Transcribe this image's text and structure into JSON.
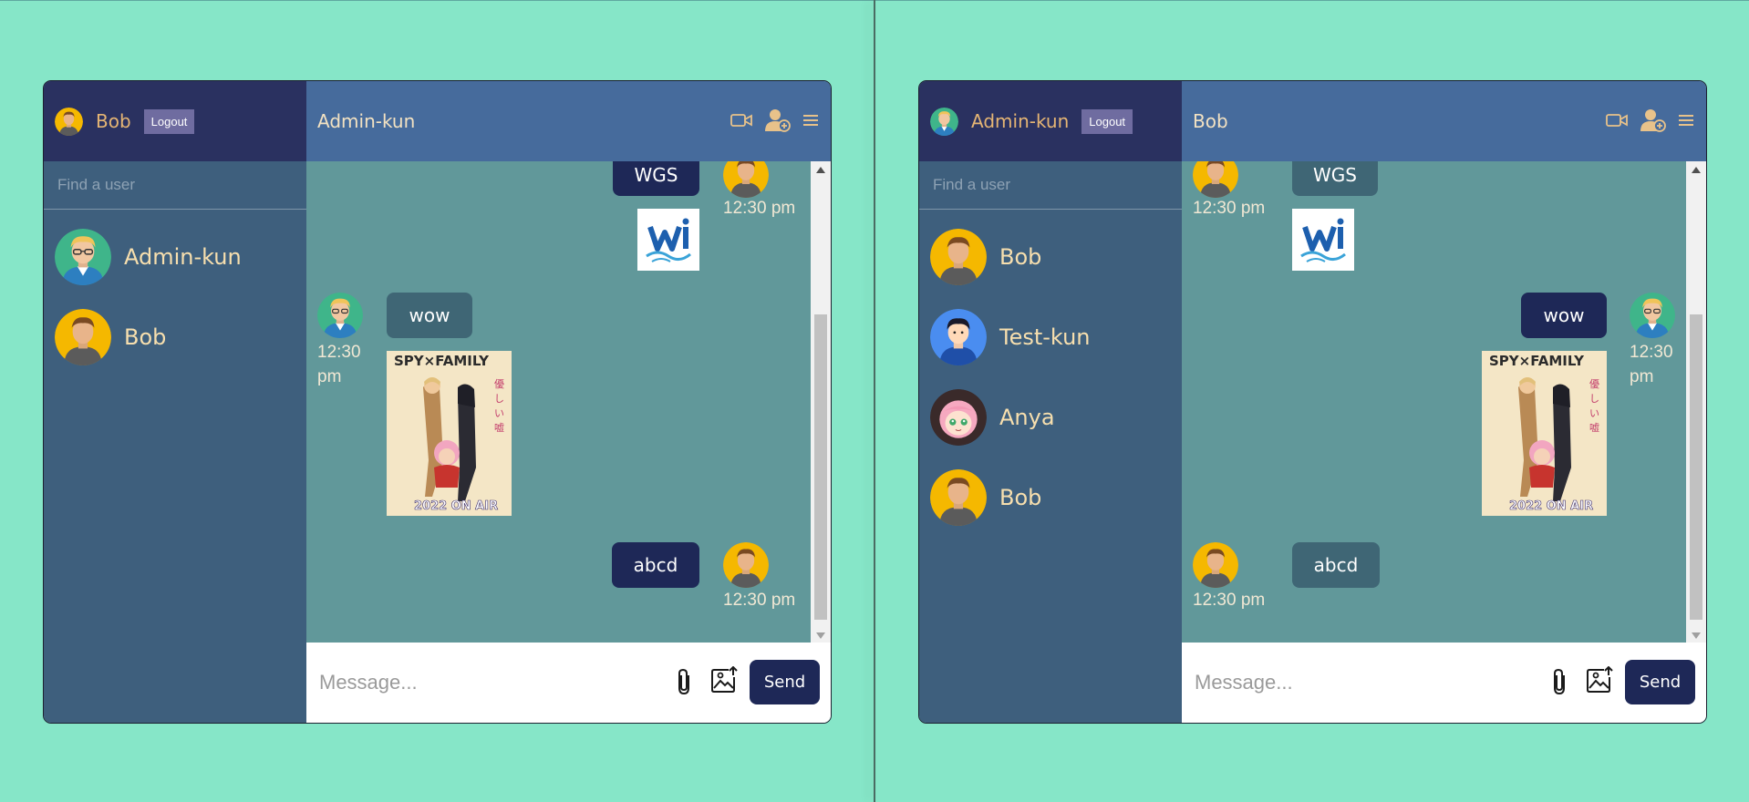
{
  "left": {
    "me": {
      "name": "Bob",
      "avatar": "bob-avatar"
    },
    "logout_label": "Logout",
    "search_placeholder": "Find a user",
    "users": [
      {
        "name": "Admin-kun",
        "avatar": "admin-avatar"
      },
      {
        "name": "Bob",
        "avatar": "bob-avatar"
      }
    ],
    "chat_title": "Admin-kun",
    "messages": [
      {
        "text": "WGS",
        "time": "12:30 pm",
        "image": "wgs-logo",
        "side": "right"
      },
      {
        "text": "wow",
        "time": "12:30 pm",
        "image": "spy-family-poster",
        "side": "left"
      },
      {
        "text": "abcd",
        "time": "12:30 pm",
        "side": "right"
      }
    ],
    "composer_placeholder": "Message...",
    "send_label": "Send"
  },
  "right": {
    "me": {
      "name": "Admin-kun",
      "avatar": "admin-avatar"
    },
    "logout_label": "Logout",
    "search_placeholder": "Find a user",
    "users": [
      {
        "name": "Bob",
        "avatar": "bob-avatar"
      },
      {
        "name": "Test-kun",
        "avatar": "test-avatar"
      },
      {
        "name": "Anya",
        "avatar": "anya-avatar"
      },
      {
        "name": "Bob",
        "avatar": "bob-avatar"
      }
    ],
    "chat_title": "Bob",
    "messages": [
      {
        "text": "WGS",
        "time": "12:30 pm",
        "image": "wgs-logo",
        "side": "left"
      },
      {
        "text": "wow",
        "time": "12:30 pm",
        "image": "spy-family-poster",
        "side": "right"
      },
      {
        "text": "abcd",
        "time": "12:30 pm",
        "side": "left"
      }
    ],
    "composer_placeholder": "Message...",
    "send_label": "Send"
  },
  "icons": [
    "video-camera-icon",
    "add-user-icon",
    "menu-icon",
    "paperclip-icon",
    "image-upload-icon"
  ],
  "colors": {
    "background": "#86e6c8",
    "sidebar": "#3e5f7d",
    "sidebar_header": "#2a3160",
    "chat_header": "#466b9c",
    "chat_area": "#61989a",
    "bubble_own": "#1e2857",
    "bubble_other": "#3f6675",
    "accent_name": "#e5b574"
  }
}
